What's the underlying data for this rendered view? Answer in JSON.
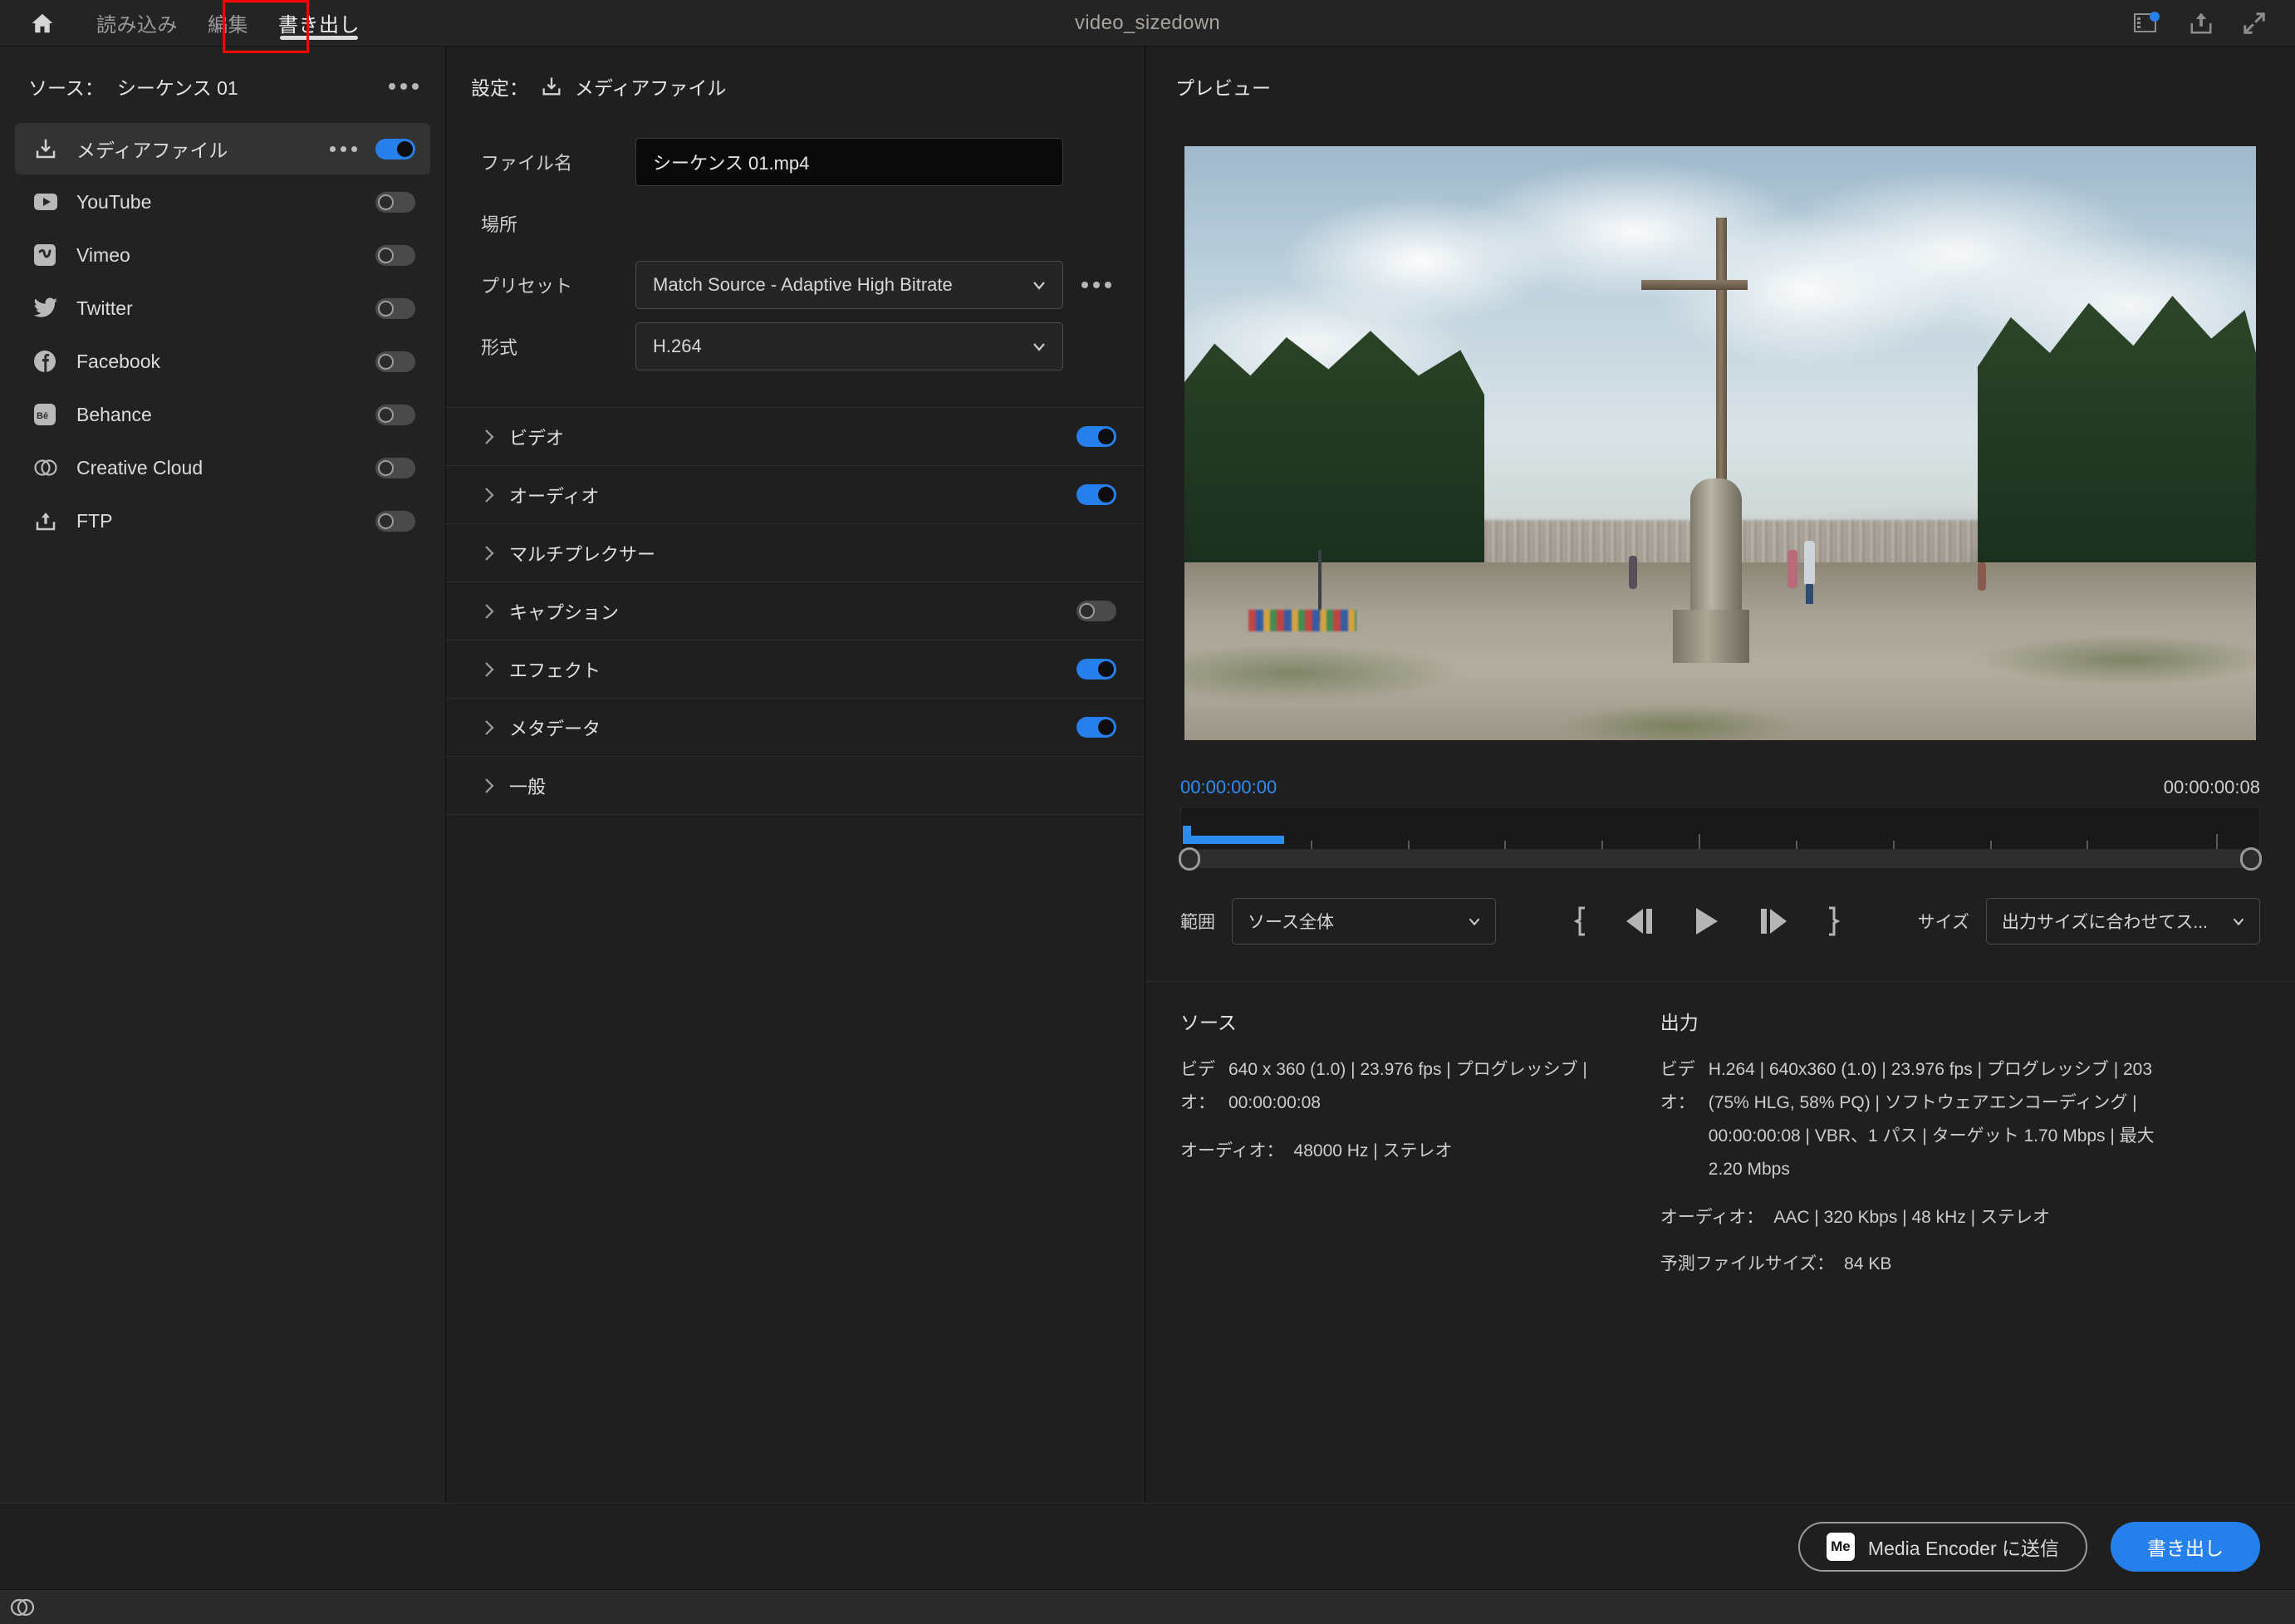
{
  "window": {
    "title": "video_sizedown",
    "nav": [
      {
        "id": "home",
        "label": "",
        "icon": "home-icon"
      },
      {
        "id": "import",
        "label": "読み込み"
      },
      {
        "id": "edit",
        "label": "編集"
      },
      {
        "id": "export",
        "label": "書き出し"
      }
    ],
    "active_nav": "書き出し",
    "highlight_color": "#ff0000",
    "right_icons": [
      "workspace-notification-icon",
      "share-icon",
      "fullscreen-icon"
    ]
  },
  "source_panel": {
    "label": "ソース：",
    "value": "シーケンス 01",
    "menu_icon": "more-options-icon",
    "destinations": [
      {
        "name": "メディアファイル",
        "icon": "media-file-icon",
        "enabled": true,
        "selected": true,
        "has_menu": true
      },
      {
        "name": "YouTube",
        "icon": "youtube-icon",
        "enabled": false,
        "selected": false,
        "has_menu": false
      },
      {
        "name": "Vimeo",
        "icon": "vimeo-icon",
        "enabled": false,
        "selected": false,
        "has_menu": false
      },
      {
        "name": "Twitter",
        "icon": "twitter-icon",
        "enabled": false,
        "selected": false,
        "has_menu": false
      },
      {
        "name": "Facebook",
        "icon": "facebook-icon",
        "enabled": false,
        "selected": false,
        "has_menu": false
      },
      {
        "name": "Behance",
        "icon": "behance-icon",
        "enabled": false,
        "selected": false,
        "has_menu": false
      },
      {
        "name": "Creative Cloud",
        "icon": "creative-cloud-icon",
        "enabled": false,
        "selected": false,
        "has_menu": false
      },
      {
        "name": "FTP",
        "icon": "ftp-upload-icon",
        "enabled": false,
        "selected": false,
        "has_menu": false
      }
    ]
  },
  "settings_panel": {
    "header_label": "設定：",
    "header_value": "メディアファイル",
    "header_icon": "media-file-icon",
    "fields": [
      {
        "id": "filename",
        "label": "ファイル名",
        "value": "シーケンス 01.mp4",
        "type": "text"
      },
      {
        "id": "location",
        "label": "場所",
        "value": "",
        "type": "text-plain"
      },
      {
        "id": "preset",
        "label": "プリセット",
        "value": "Match Source - Adaptive High Bitrate",
        "type": "select",
        "has_menu": true
      },
      {
        "id": "format",
        "label": "形式",
        "value": "H.264",
        "type": "select",
        "has_menu": false
      }
    ],
    "sections": [
      {
        "id": "video",
        "label": "ビデオ",
        "toggle": "on"
      },
      {
        "id": "audio",
        "label": "オーディオ",
        "toggle": "on"
      },
      {
        "id": "multiplexer",
        "label": "マルチプレクサー",
        "toggle": "none"
      },
      {
        "id": "captions",
        "label": "キャプション",
        "toggle": "off"
      },
      {
        "id": "effects",
        "label": "エフェクト",
        "toggle": "on"
      },
      {
        "id": "metadata",
        "label": "メタデータ",
        "toggle": "on"
      },
      {
        "id": "general",
        "label": "一般",
        "toggle": "none"
      }
    ]
  },
  "preview_panel": {
    "title": "プレビュー",
    "timecode_start": "00:00:00:00",
    "timecode_end": "00:00:00:08",
    "range_label": "範囲",
    "range_value": "ソース全体",
    "size_label": "サイズ",
    "size_value": "出力サイズに合わせてス...",
    "transport": [
      "set-in-point-icon",
      "step-back-icon",
      "play-icon",
      "step-forward-icon",
      "set-out-point-icon"
    ]
  },
  "info": {
    "source": {
      "heading": "ソース",
      "video_key": "ビデオ：",
      "video_value": "640 x 360 (1.0) | 23.976 fps | プログレッシブ |",
      "duration_value": "00:00:00:08",
      "audio_key": "オーディオ：",
      "audio_value": "48000 Hz | ステレオ"
    },
    "output": {
      "heading": "出力",
      "video_key": "ビデオ：",
      "video_line1": "H.264 | 640x360 (1.0) | 23.976 fps | プログレッシブ | 203",
      "video_line2": "(75% HLG, 58% PQ) | ソフトウェアエンコーディング |",
      "duration_line": "00:00:00:08 | VBR、1 パス | ターゲット 1.70 Mbps | 最大",
      "duration_line2": "2.20 Mbps",
      "audio_key": "オーディオ：",
      "audio_value": "AAC | 320 Kbps | 48 kHz | ステレオ",
      "filesize_key": "予測ファイルサイズ：",
      "filesize_value": "84 KB"
    }
  },
  "footer": {
    "media_encoder_label": "Media Encoder に送信",
    "media_encoder_badge": "Me",
    "export_label": "書き出し",
    "accent_color": "#2680eb"
  },
  "statusbar": {
    "icon": "creative-cloud-icon"
  }
}
